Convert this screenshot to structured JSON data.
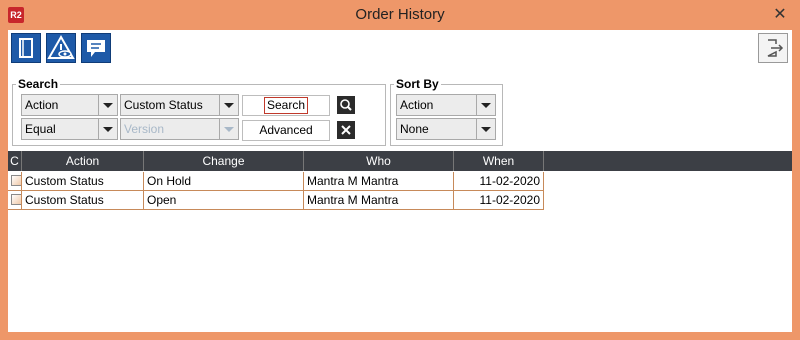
{
  "window": {
    "app_badge": "R2",
    "title": "Order History",
    "close_glyph": "✕"
  },
  "toolbar": {
    "icons": [
      "book-icon",
      "alert-eye-icon",
      "comment-icon"
    ],
    "exit_icon": "exit-icon"
  },
  "search": {
    "title": "Search",
    "field_combo": "Action",
    "value_combo": "Custom Status",
    "operator_combo": "Equal",
    "version_combo": "Version",
    "search_button": "Search",
    "advanced_button": "Advanced"
  },
  "sort": {
    "title": "Sort By",
    "primary": "Action",
    "secondary": "None"
  },
  "grid": {
    "columns": [
      "C",
      "Action",
      "Change",
      "Who",
      "When"
    ],
    "rows": [
      {
        "action": "Custom Status",
        "change": "On Hold",
        "who": "Mantra M Mantra",
        "when": "11-02-2020"
      },
      {
        "action": "Custom Status",
        "change": "Open",
        "who": "Mantra M Mantra",
        "when": "11-02-2020"
      }
    ]
  },
  "colors": {
    "frame": "#ee9769",
    "toolbar_blue": "#1e5aa8",
    "grid_header": "#3c3f45"
  }
}
